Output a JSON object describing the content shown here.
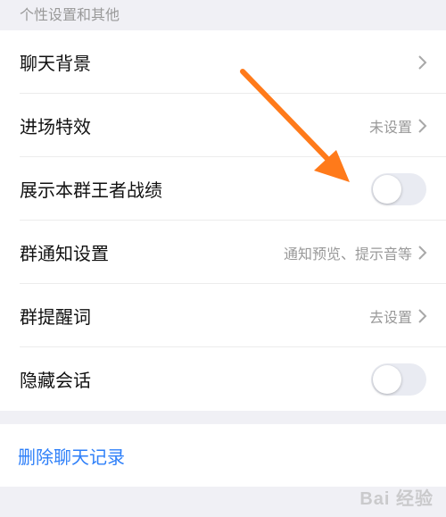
{
  "section": {
    "header": "个性设置和其他"
  },
  "rows": [
    {
      "label": "聊天背景",
      "value": "",
      "control": "chevron"
    },
    {
      "label": "进场特效",
      "value": "未设置",
      "control": "chevron"
    },
    {
      "label": "展示本群王者战绩",
      "value": "",
      "control": "toggle",
      "toggle_on": false
    },
    {
      "label": "群通知设置",
      "value": "通知预览、提示音等",
      "control": "chevron"
    },
    {
      "label": "群提醒词",
      "value": "去设置",
      "control": "chevron"
    },
    {
      "label": "隐藏会话",
      "value": "",
      "control": "toggle",
      "toggle_on": false
    }
  ],
  "delete_history": {
    "label": "删除聊天记录"
  },
  "watermark": {
    "text": "Bai 经验"
  },
  "colors": {
    "background": "#f0f0f5",
    "link_blue": "#2d7ff9",
    "arrow_orange": "#ff7a1a",
    "secondary_text": "#999999"
  },
  "icons": {
    "chevron": "chevron-right-icon",
    "arrow": "orange-arrow-icon"
  }
}
